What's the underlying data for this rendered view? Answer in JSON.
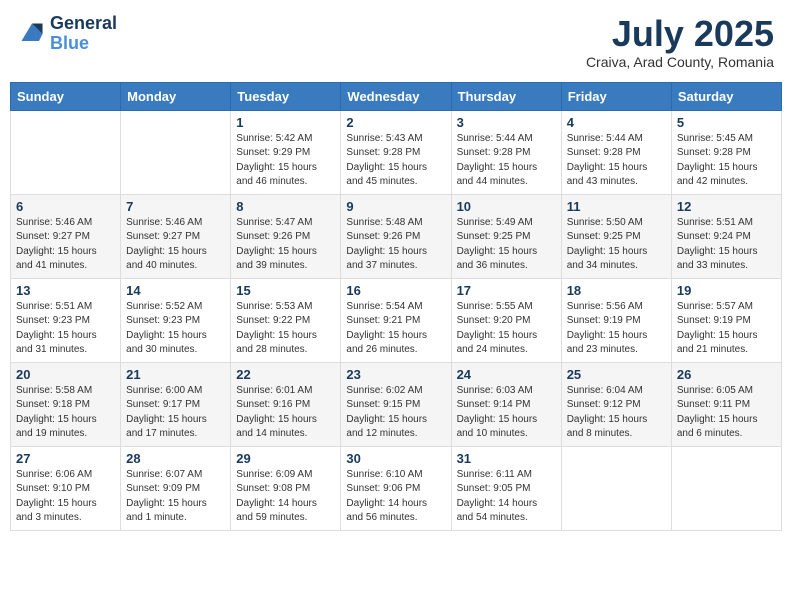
{
  "header": {
    "logo": {
      "line1": "General",
      "line2": "Blue"
    },
    "month": "July 2025",
    "location": "Craiva, Arad County, Romania"
  },
  "weekdays": [
    "Sunday",
    "Monday",
    "Tuesday",
    "Wednesday",
    "Thursday",
    "Friday",
    "Saturday"
  ],
  "weeks": [
    [
      null,
      null,
      {
        "day": "1",
        "sunrise": "Sunrise: 5:42 AM",
        "sunset": "Sunset: 9:29 PM",
        "daylight": "Daylight: 15 hours and 46 minutes."
      },
      {
        "day": "2",
        "sunrise": "Sunrise: 5:43 AM",
        "sunset": "Sunset: 9:28 PM",
        "daylight": "Daylight: 15 hours and 45 minutes."
      },
      {
        "day": "3",
        "sunrise": "Sunrise: 5:44 AM",
        "sunset": "Sunset: 9:28 PM",
        "daylight": "Daylight: 15 hours and 44 minutes."
      },
      {
        "day": "4",
        "sunrise": "Sunrise: 5:44 AM",
        "sunset": "Sunset: 9:28 PM",
        "daylight": "Daylight: 15 hours and 43 minutes."
      },
      {
        "day": "5",
        "sunrise": "Sunrise: 5:45 AM",
        "sunset": "Sunset: 9:28 PM",
        "daylight": "Daylight: 15 hours and 42 minutes."
      }
    ],
    [
      {
        "day": "6",
        "sunrise": "Sunrise: 5:46 AM",
        "sunset": "Sunset: 9:27 PM",
        "daylight": "Daylight: 15 hours and 41 minutes."
      },
      {
        "day": "7",
        "sunrise": "Sunrise: 5:46 AM",
        "sunset": "Sunset: 9:27 PM",
        "daylight": "Daylight: 15 hours and 40 minutes."
      },
      {
        "day": "8",
        "sunrise": "Sunrise: 5:47 AM",
        "sunset": "Sunset: 9:26 PM",
        "daylight": "Daylight: 15 hours and 39 minutes."
      },
      {
        "day": "9",
        "sunrise": "Sunrise: 5:48 AM",
        "sunset": "Sunset: 9:26 PM",
        "daylight": "Daylight: 15 hours and 37 minutes."
      },
      {
        "day": "10",
        "sunrise": "Sunrise: 5:49 AM",
        "sunset": "Sunset: 9:25 PM",
        "daylight": "Daylight: 15 hours and 36 minutes."
      },
      {
        "day": "11",
        "sunrise": "Sunrise: 5:50 AM",
        "sunset": "Sunset: 9:25 PM",
        "daylight": "Daylight: 15 hours and 34 minutes."
      },
      {
        "day": "12",
        "sunrise": "Sunrise: 5:51 AM",
        "sunset": "Sunset: 9:24 PM",
        "daylight": "Daylight: 15 hours and 33 minutes."
      }
    ],
    [
      {
        "day": "13",
        "sunrise": "Sunrise: 5:51 AM",
        "sunset": "Sunset: 9:23 PM",
        "daylight": "Daylight: 15 hours and 31 minutes."
      },
      {
        "day": "14",
        "sunrise": "Sunrise: 5:52 AM",
        "sunset": "Sunset: 9:23 PM",
        "daylight": "Daylight: 15 hours and 30 minutes."
      },
      {
        "day": "15",
        "sunrise": "Sunrise: 5:53 AM",
        "sunset": "Sunset: 9:22 PM",
        "daylight": "Daylight: 15 hours and 28 minutes."
      },
      {
        "day": "16",
        "sunrise": "Sunrise: 5:54 AM",
        "sunset": "Sunset: 9:21 PM",
        "daylight": "Daylight: 15 hours and 26 minutes."
      },
      {
        "day": "17",
        "sunrise": "Sunrise: 5:55 AM",
        "sunset": "Sunset: 9:20 PM",
        "daylight": "Daylight: 15 hours and 24 minutes."
      },
      {
        "day": "18",
        "sunrise": "Sunrise: 5:56 AM",
        "sunset": "Sunset: 9:19 PM",
        "daylight": "Daylight: 15 hours and 23 minutes."
      },
      {
        "day": "19",
        "sunrise": "Sunrise: 5:57 AM",
        "sunset": "Sunset: 9:19 PM",
        "daylight": "Daylight: 15 hours and 21 minutes."
      }
    ],
    [
      {
        "day": "20",
        "sunrise": "Sunrise: 5:58 AM",
        "sunset": "Sunset: 9:18 PM",
        "daylight": "Daylight: 15 hours and 19 minutes."
      },
      {
        "day": "21",
        "sunrise": "Sunrise: 6:00 AM",
        "sunset": "Sunset: 9:17 PM",
        "daylight": "Daylight: 15 hours and 17 minutes."
      },
      {
        "day": "22",
        "sunrise": "Sunrise: 6:01 AM",
        "sunset": "Sunset: 9:16 PM",
        "daylight": "Daylight: 15 hours and 14 minutes."
      },
      {
        "day": "23",
        "sunrise": "Sunrise: 6:02 AM",
        "sunset": "Sunset: 9:15 PM",
        "daylight": "Daylight: 15 hours and 12 minutes."
      },
      {
        "day": "24",
        "sunrise": "Sunrise: 6:03 AM",
        "sunset": "Sunset: 9:14 PM",
        "daylight": "Daylight: 15 hours and 10 minutes."
      },
      {
        "day": "25",
        "sunrise": "Sunrise: 6:04 AM",
        "sunset": "Sunset: 9:12 PM",
        "daylight": "Daylight: 15 hours and 8 minutes."
      },
      {
        "day": "26",
        "sunrise": "Sunrise: 6:05 AM",
        "sunset": "Sunset: 9:11 PM",
        "daylight": "Daylight: 15 hours and 6 minutes."
      }
    ],
    [
      {
        "day": "27",
        "sunrise": "Sunrise: 6:06 AM",
        "sunset": "Sunset: 9:10 PM",
        "daylight": "Daylight: 15 hours and 3 minutes."
      },
      {
        "day": "28",
        "sunrise": "Sunrise: 6:07 AM",
        "sunset": "Sunset: 9:09 PM",
        "daylight": "Daylight: 15 hours and 1 minute."
      },
      {
        "day": "29",
        "sunrise": "Sunrise: 6:09 AM",
        "sunset": "Sunset: 9:08 PM",
        "daylight": "Daylight: 14 hours and 59 minutes."
      },
      {
        "day": "30",
        "sunrise": "Sunrise: 6:10 AM",
        "sunset": "Sunset: 9:06 PM",
        "daylight": "Daylight: 14 hours and 56 minutes."
      },
      {
        "day": "31",
        "sunrise": "Sunrise: 6:11 AM",
        "sunset": "Sunset: 9:05 PM",
        "daylight": "Daylight: 14 hours and 54 minutes."
      },
      null,
      null
    ]
  ]
}
